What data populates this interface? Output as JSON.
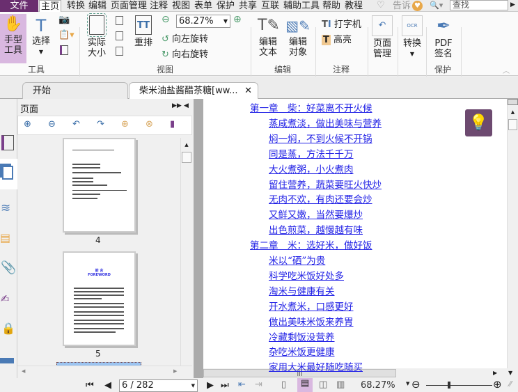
{
  "menu": {
    "file": "文件",
    "tabs": [
      "主页",
      "转换",
      "编辑",
      "页面管理",
      "注释",
      "视图",
      "表单",
      "保护",
      "共享",
      "互联",
      "辅助工具",
      "帮助",
      "教程"
    ],
    "tell": "告诉",
    "search_placeholder": "查找"
  },
  "ribbon": {
    "hand": "手型\n工具",
    "select": "选择",
    "actual_size": "实际\n大小",
    "reflow": "重排",
    "zoom_value": "68.27%",
    "rotate_left": "向左旋转",
    "rotate_right": "向右旋转",
    "edit_text": "编辑\n文本",
    "edit_object": "编辑\n对象",
    "typewriter": "打字机",
    "highlight": "高亮",
    "page_manage": "页面\n管理",
    "convert": "转换",
    "pdf_sign": "PDF\n签名",
    "groups": {
      "tools": "工具",
      "view": "视图",
      "edit": "编辑",
      "comment": "注释",
      "protect": "保护"
    }
  },
  "tabs": {
    "start": "开始",
    "document": "柴米油盐酱醋茶糖[ww..."
  },
  "panel": {
    "title": "页面",
    "thumbnails": [
      {
        "page": "4"
      },
      {
        "page": "5",
        "heading": "前 言",
        "subheading": "FOREWORD"
      }
    ]
  },
  "document": {
    "toc": [
      {
        "level": 1,
        "text": "第一章　柴：好菜离不开火候"
      },
      {
        "level": 2,
        "text": "蒸咸煮淡，做出美味与营养"
      },
      {
        "level": 2,
        "text": "焖一焖，不到火候不开锅"
      },
      {
        "level": 2,
        "text": "同是蒸，方法千千万"
      },
      {
        "level": 2,
        "text": "大火煮粥，小火煮肉"
      },
      {
        "level": 2,
        "text": "留住营养，蔬菜要旺火快炒"
      },
      {
        "level": 2,
        "text": "无肉不欢，有肉还要会炒"
      },
      {
        "level": 2,
        "text": "又鲜又嫩，当然要爆炒"
      },
      {
        "level": 2,
        "text": "出色煎菜，越慢越有味"
      },
      {
        "level": 1,
        "text": "第二章　米：选好米，做好饭"
      },
      {
        "level": 2,
        "text": "米以“硒”为贵"
      },
      {
        "level": 2,
        "text": "科学吃米饭好处多"
      },
      {
        "level": 2,
        "text": "淘米与健康有关"
      },
      {
        "level": 2,
        "text": "开水煮米，口感更好"
      },
      {
        "level": 2,
        "text": "做出美味米饭来养胃"
      },
      {
        "level": 2,
        "text": "冷藏剩饭没营养"
      },
      {
        "level": 2,
        "text": "杂吃米饭更健康"
      },
      {
        "level": 2,
        "text": "家用大米最好随吃随买"
      }
    ]
  },
  "status": {
    "page_input": "6 / 282",
    "zoom": "68.27%"
  },
  "colors": {
    "brand": "#6a2e6f",
    "link": "#2323e6",
    "hand_active": "#d9b8e0"
  }
}
